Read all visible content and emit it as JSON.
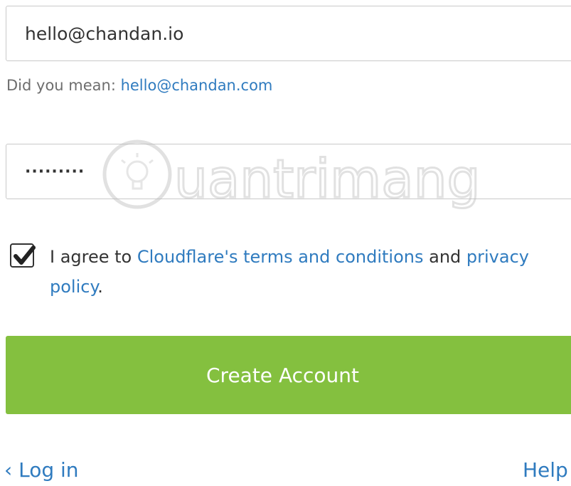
{
  "form": {
    "email_value": "hello@chandan.io",
    "suggestion_prefix": "Did you mean: ",
    "suggestion_link": "hello@chandan.com",
    "password_value": "·········",
    "terms_checked": true,
    "agree_prefix": "I agree to ",
    "terms_link": "Cloudflare's terms and conditions",
    "agree_middle": " and ",
    "privacy_link": "privacy policy",
    "agree_suffix": ".",
    "create_button": "Create Account"
  },
  "footer": {
    "login_link": "‹ Log in",
    "help_link": "Help"
  },
  "watermark": {
    "text": "uantrimang"
  },
  "colors": {
    "accent_green": "#84c03f",
    "link_blue": "#2f7bbf",
    "border": "#c9c9c9"
  }
}
